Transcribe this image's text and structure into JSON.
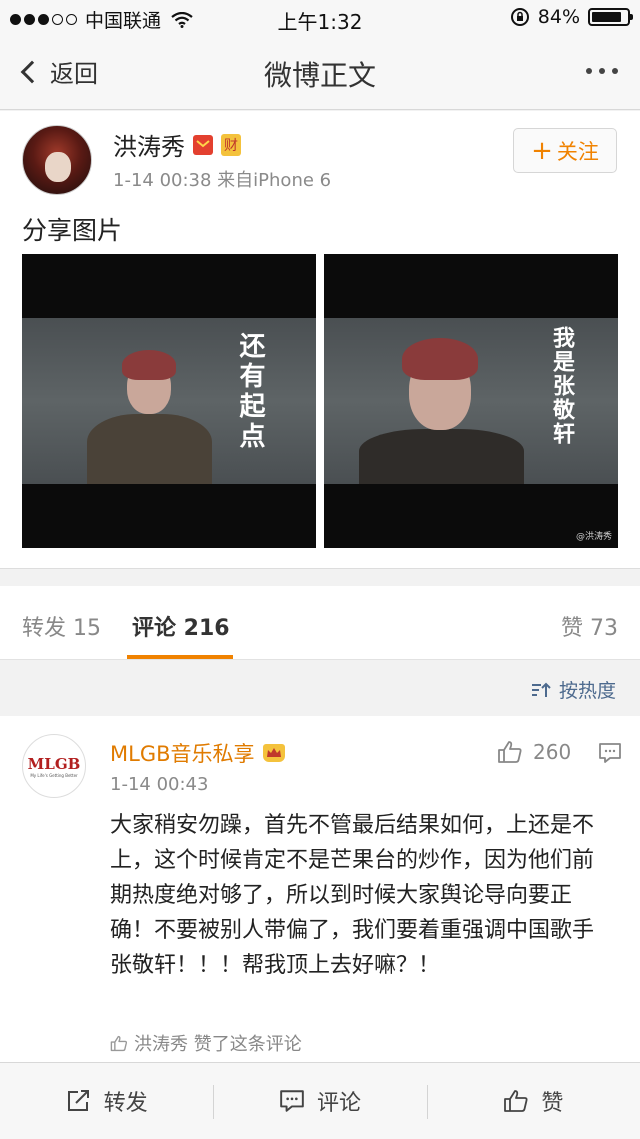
{
  "status_bar": {
    "carrier": "中国联通",
    "time": "上午1:32",
    "battery_text": "84%",
    "battery_level": 0.84,
    "signal_bars": 3,
    "signal_total": 5
  },
  "nav": {
    "back_label": "返回",
    "title": "微博正文"
  },
  "post": {
    "author": "洪涛秀",
    "badge_vip": "VIP",
    "badge_wealth": "财",
    "meta": "1-14 00:38  来自iPhone 6",
    "follow_label": "关注",
    "text": "分享图片",
    "images": [
      {
        "caption": "还有起点"
      },
      {
        "caption": "我是张敬轩",
        "watermark": "@洪涛秀"
      }
    ]
  },
  "tabs": {
    "repost": "转发 15",
    "comments": "评论 216",
    "likes": "赞 73"
  },
  "sort_label": "按热度",
  "comment": {
    "avatar_logo": "MLGB",
    "avatar_sub": "My Life's Getting Better",
    "author": "MLGB音乐私享",
    "time": "1-14 00:43",
    "like_count": "260",
    "text": "大家稍安勿躁，首先不管最后结果如何，上还是不上，这个时候肯定不是芒果台的炒作，因为他们前期热度绝对够了，所以到时候大家舆论导向要正确！不要被别人带偏了，我们要着重强调中国歌手张敬轩！！！帮我顶上去好嘛？！",
    "liked_by": "洪涛秀 赞了这条评论"
  },
  "bottom_bar": {
    "repost": "转发",
    "comment": "评论",
    "like": "赞"
  },
  "colors": {
    "accent": "#f08200",
    "link": "#4d6a8e",
    "username_orange": "#e07b00"
  }
}
